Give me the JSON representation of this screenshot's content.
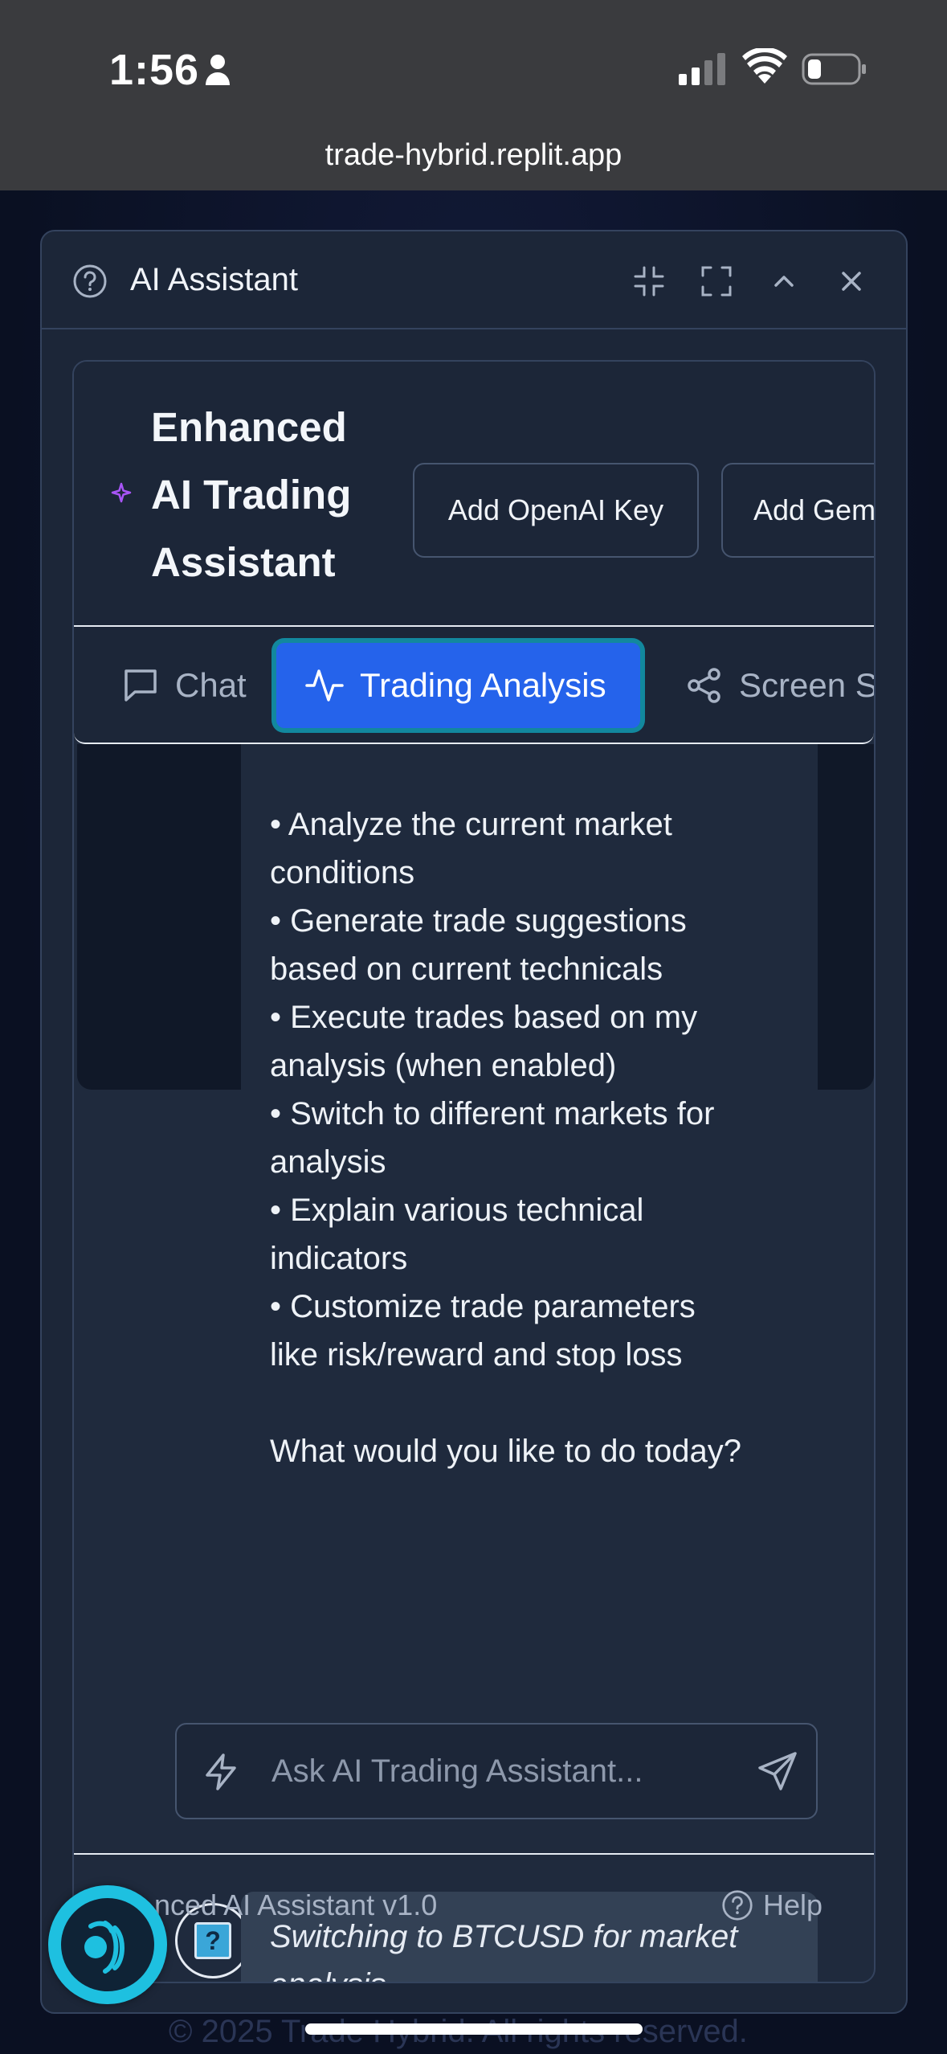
{
  "status_bar": {
    "time": "1:56",
    "url": "trade-hybrid.replit.app"
  },
  "background": {
    "footer_text": "© 2025 Trade Hybrid. All rights reserved."
  },
  "dialog": {
    "title": "AI Assistant",
    "header_icons": [
      "minimize-icon",
      "fullscreen-icon",
      "collapse-icon",
      "close-icon"
    ]
  },
  "card": {
    "title": "Enhanced AI Trading Assistant",
    "buttons": {
      "openai": "Add OpenAI Key",
      "gemini": "Add Gemini"
    },
    "tabs": [
      {
        "label": "Chat",
        "icon": "chat-bubble-icon",
        "active": false
      },
      {
        "label": "Trading Analysis",
        "icon": "activity-icon",
        "active": true
      },
      {
        "label": "Screen S",
        "icon": "share-icon",
        "active": false
      }
    ]
  },
  "messages": {
    "assistant": [
      "• Analyze the current market",
      "conditions",
      "• Generate trade suggestions",
      "based on current technicals",
      "• Execute trades based on my",
      "analysis (when enabled)",
      "• Switch to different markets for",
      "analysis",
      "• Explain various technical",
      "indicators",
      "• Customize trade parameters",
      "like risk/reward and stop loss"
    ],
    "assistant_question": "What would you like to do today?",
    "system": "Switching to BTCUSD for market analysis."
  },
  "input": {
    "placeholder": "Ask AI Trading Assistant..."
  },
  "footer": {
    "version": "nced AI Assistant v1.0",
    "help": "Help"
  },
  "colors": {
    "accent": "#2563eb",
    "fab": "#1ec0e0",
    "panel": "#1c2638"
  }
}
